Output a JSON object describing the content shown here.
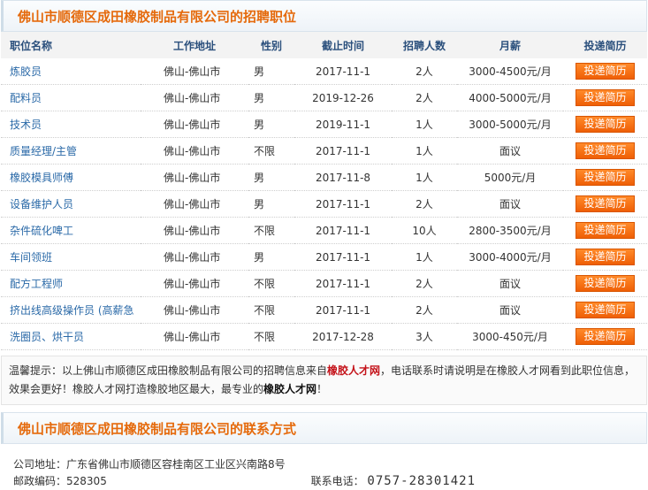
{
  "jobs_header": {
    "title": "佛山市顺德区成田橡胶制品有限公司的招聘职位"
  },
  "columns": [
    "职位名称",
    "工作地址",
    "性别",
    "截止时间",
    "招聘人数",
    "月薪",
    "投递简历"
  ],
  "apply_label": "投递简历",
  "jobs": [
    {
      "name": "炼胶员",
      "location": "佛山-佛山市",
      "gender": "男",
      "deadline": "2017-11-1",
      "count": "2人",
      "salary": "3000-4500元/月"
    },
    {
      "name": "配料员",
      "location": "佛山-佛山市",
      "gender": "男",
      "deadline": "2019-12-26",
      "count": "2人",
      "salary": "4000-5000元/月"
    },
    {
      "name": "技术员",
      "location": "佛山-佛山市",
      "gender": "男",
      "deadline": "2019-11-1",
      "count": "1人",
      "salary": "3000-5000元/月"
    },
    {
      "name": "质量经理/主管",
      "location": "佛山-佛山市",
      "gender": "不限",
      "deadline": "2017-11-1",
      "count": "1人",
      "salary": "面议"
    },
    {
      "name": "橡胶模具师傅",
      "location": "佛山-佛山市",
      "gender": "男",
      "deadline": "2017-11-8",
      "count": "1人",
      "salary": "5000元/月"
    },
    {
      "name": "设备维护人员",
      "location": "佛山-佛山市",
      "gender": "男",
      "deadline": "2017-11-1",
      "count": "2人",
      "salary": "面议"
    },
    {
      "name": "杂件硫化啤工",
      "location": "佛山-佛山市",
      "gender": "不限",
      "deadline": "2017-11-1",
      "count": "10人",
      "salary": "2800-3500元/月"
    },
    {
      "name": "车间领班",
      "location": "佛山-佛山市",
      "gender": "男",
      "deadline": "2017-11-1",
      "count": "1人",
      "salary": "3000-4000元/月"
    },
    {
      "name": "配方工程师",
      "location": "佛山-佛山市",
      "gender": "不限",
      "deadline": "2017-11-1",
      "count": "2人",
      "salary": "面议"
    },
    {
      "name": "挤出线高级操作员 (高薪急",
      "location": "佛山-佛山市",
      "gender": "不限",
      "deadline": "2017-11-1",
      "count": "2人",
      "salary": "面议"
    },
    {
      "name": "洗圈员、烘干员",
      "location": "佛山-佛山市",
      "gender": "不限",
      "deadline": "2017-12-28",
      "count": "3人",
      "salary": "3000-450元/月"
    }
  ],
  "tips": {
    "prefix": "温馨提示：以上佛山市顺德区成田橡胶制品有限公司的招聘信息来自",
    "site1": "橡胶人才网",
    "middle": "，电话联系时请说明是在橡胶人才网看到此职位信息，效果会更好！橡胶人才网打造橡胶地区最大，最专业的",
    "site2": "橡胶人才网",
    "suffix": "！"
  },
  "contact_header": {
    "title": "佛山市顺德区成田橡胶制品有限公司的联系方式"
  },
  "contact": {
    "address_label": "公司地址：",
    "address": "广东省佛山市顺德区容桂南区工业区兴南路8号",
    "postcode_label": "邮政编码：",
    "postcode": "528305",
    "phone_label": "联系电话：",
    "phone": "0757-28301421"
  }
}
